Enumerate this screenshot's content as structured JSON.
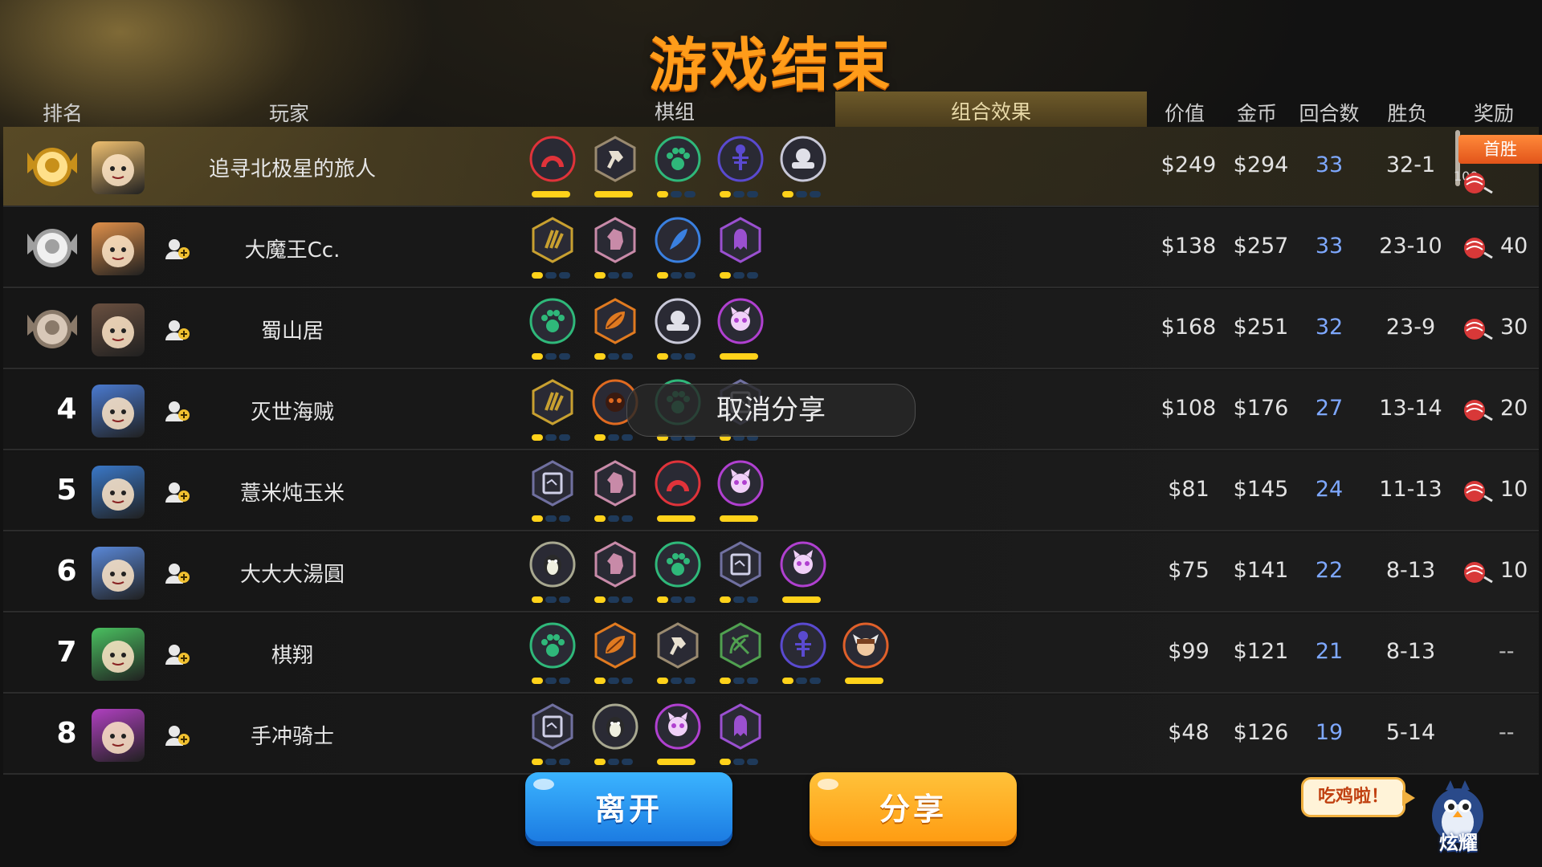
{
  "title": "游戏结束",
  "columns": {
    "rank": "排名",
    "player": "玩家",
    "deck": "棋组",
    "combo": "组合效果",
    "value": "价值",
    "gold": "金币",
    "rounds": "回合数",
    "winloss": "胜负",
    "reward": "奖励"
  },
  "first_win_badge": "首胜",
  "players": [
    {
      "rank": "1",
      "name": "追寻北极星的旅人",
      "value": "$249",
      "gold": "$294",
      "rounds": "33",
      "winloss": "32-1",
      "reward": "100",
      "deck": [
        {
          "icon": "arch-icon",
          "color": "#e0333a",
          "level": 3
        },
        {
          "icon": "axe-icon",
          "color": "#9a8a70",
          "level": 3
        },
        {
          "icon": "paw-icon",
          "color": "#2fb87a",
          "level": 1
        },
        {
          "icon": "fish-bone-icon",
          "color": "#5a4ad0",
          "level": 1
        },
        {
          "icon": "helmet-icon",
          "color": "#c8c8d8",
          "level": 1
        }
      ]
    },
    {
      "rank": "2",
      "name": "大魔王Cc.",
      "value": "$138",
      "gold": "$257",
      "rounds": "33",
      "winloss": "23-10",
      "reward": "40",
      "deck": [
        {
          "icon": "claw-icon",
          "color": "#c8a030",
          "level": 1
        },
        {
          "icon": "horse-icon",
          "color": "#c88aa8",
          "level": 1
        },
        {
          "icon": "feather-icon",
          "color": "#3a80e0",
          "level": 1
        },
        {
          "icon": "ghost-icon",
          "color": "#9a50d0",
          "level": 1
        }
      ]
    },
    {
      "rank": "3",
      "name": "蜀山居",
      "value": "$168",
      "gold": "$251",
      "rounds": "32",
      "winloss": "23-9",
      "reward": "30",
      "deck": [
        {
          "icon": "paw-icon",
          "color": "#2fb87a",
          "level": 1
        },
        {
          "icon": "leaf-icon",
          "color": "#e07a20",
          "level": 1
        },
        {
          "icon": "helmet-icon",
          "color": "#c8c8d8",
          "level": 1
        },
        {
          "icon": "demon-icon",
          "color": "#b040d0",
          "level": 3
        }
      ]
    },
    {
      "rank": "4",
      "name": "灭世海贼",
      "value": "$108",
      "gold": "$176",
      "rounds": "27",
      "winloss": "13-14",
      "reward": "20",
      "deck": [
        {
          "icon": "claw-icon",
          "color": "#c8a030",
          "level": 1
        },
        {
          "icon": "mask-icon",
          "color": "#e06a20",
          "level": 1
        },
        {
          "icon": "paw-icon",
          "color": "#2fb87a",
          "level": 1
        },
        {
          "icon": "book-icon",
          "color": "#7070a0",
          "level": 1
        }
      ]
    },
    {
      "rank": "5",
      "name": "薏米炖玉米",
      "value": "$81",
      "gold": "$145",
      "rounds": "24",
      "winloss": "11-13",
      "reward": "10",
      "deck": [
        {
          "icon": "book-icon",
          "color": "#7070a0",
          "level": 1
        },
        {
          "icon": "horse-icon",
          "color": "#c88aa8",
          "level": 1
        },
        {
          "icon": "arch-icon",
          "color": "#e0333a",
          "level": 3
        },
        {
          "icon": "demon-icon",
          "color": "#b040d0",
          "level": 3
        }
      ]
    },
    {
      "rank": "6",
      "name": "大大大湯圓",
      "value": "$75",
      "gold": "$141",
      "rounds": "22",
      "winloss": "8-13",
      "reward": "10",
      "deck": [
        {
          "icon": "penguin-icon",
          "color": "#a8a890",
          "level": 1
        },
        {
          "icon": "horse-icon",
          "color": "#c88aa8",
          "level": 1
        },
        {
          "icon": "paw-icon",
          "color": "#2fb87a",
          "level": 1
        },
        {
          "icon": "book-icon",
          "color": "#7070a0",
          "level": 1
        },
        {
          "icon": "demon-icon",
          "color": "#b040d0",
          "level": 3
        }
      ]
    },
    {
      "rank": "7",
      "name": "棋翔",
      "value": "$99",
      "gold": "$121",
      "rounds": "21",
      "winloss": "8-13",
      "reward": "--",
      "deck": [
        {
          "icon": "paw-icon",
          "color": "#2fb87a",
          "level": 1
        },
        {
          "icon": "leaf-icon",
          "color": "#e07a20",
          "level": 1
        },
        {
          "icon": "axe-icon",
          "color": "#9a8a70",
          "level": 1
        },
        {
          "icon": "bow-icon",
          "color": "#50a050",
          "level": 1
        },
        {
          "icon": "fish-bone-icon",
          "color": "#5a4ad0",
          "level": 1
        },
        {
          "icon": "viking-icon",
          "color": "#e0602a",
          "level": 3
        }
      ]
    },
    {
      "rank": "8",
      "name": "手冲骑士",
      "value": "$48",
      "gold": "$126",
      "rounds": "19",
      "winloss": "5-14",
      "reward": "--",
      "deck": [
        {
          "icon": "book-icon",
          "color": "#7070a0",
          "level": 1
        },
        {
          "icon": "penguin-icon",
          "color": "#a8a890",
          "level": 1
        },
        {
          "icon": "demon-icon",
          "color": "#b040d0",
          "level": 3
        },
        {
          "icon": "ghost-icon",
          "color": "#9a50d0",
          "level": 1
        }
      ]
    }
  ],
  "toast": "取消分享",
  "buttons": {
    "leave": "离开",
    "share": "分享"
  },
  "mascot": {
    "bubble": "吃鸡啦！",
    "label": "炫耀"
  },
  "colors": {
    "title": "#ff9c1a",
    "rounds_text": "#7ea8ff",
    "pip_active": "#ffd21a",
    "pip_inactive": "#1f3a5a"
  }
}
